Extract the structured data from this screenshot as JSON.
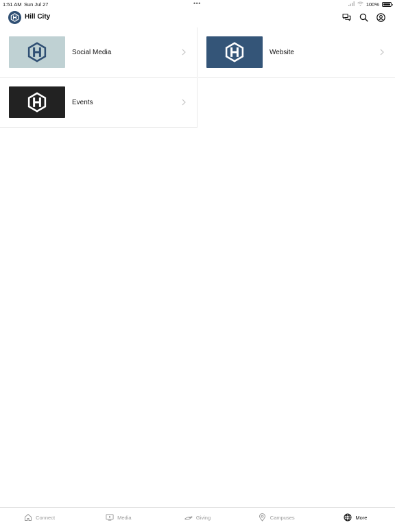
{
  "status_bar": {
    "time": "1:51 AM",
    "date": "Sun Jul 27",
    "dots": "•••",
    "battery": "100%"
  },
  "header": {
    "title": "Hill City",
    "brand_color": "#2f4f73",
    "actions": [
      {
        "name": "messages",
        "icon": "chat-bubbles-icon"
      },
      {
        "name": "search",
        "icon": "search-icon"
      },
      {
        "name": "account",
        "icon": "profile-icon"
      }
    ]
  },
  "tiles": [
    {
      "label": "Social Media",
      "thumb_bg": "#bfd1d3",
      "logo_color": "#2f4f73"
    },
    {
      "label": "Website",
      "thumb_bg": "#345578",
      "logo_color": "#ffffff"
    },
    {
      "label": "Events",
      "thumb_bg": "#222222",
      "logo_color": "#ffffff"
    }
  ],
  "tab_bar": {
    "tabs": [
      {
        "label": "Connect",
        "icon": "home-icon",
        "active": false
      },
      {
        "label": "Media",
        "icon": "play-screen-icon",
        "active": false
      },
      {
        "label": "Giving",
        "icon": "giving-hand-icon",
        "active": false
      },
      {
        "label": "Campuses",
        "icon": "location-pin-icon",
        "active": false
      },
      {
        "label": "More",
        "icon": "globe-icon",
        "active": true
      }
    ]
  }
}
